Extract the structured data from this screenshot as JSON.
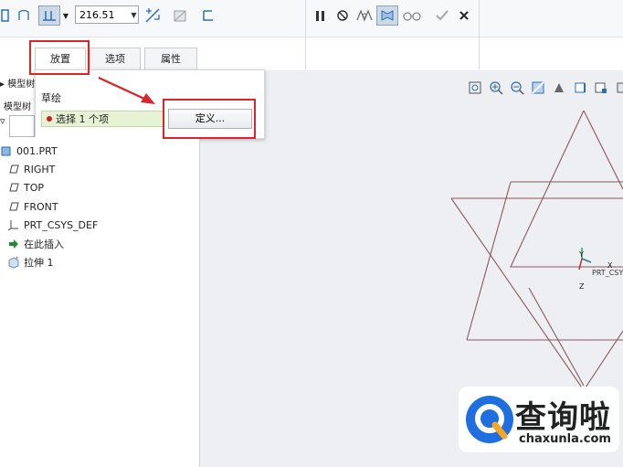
{
  "toolbar": {
    "dimension_value": "216.51"
  },
  "tabs": [
    {
      "label": "放置"
    },
    {
      "label": "选项"
    },
    {
      "label": "属性"
    }
  ],
  "left_partial": {
    "model_label_1": "模型树",
    "model_label_2": "模型树"
  },
  "panel": {
    "sketch_label": "草绘",
    "collector_text": "选择 1 个项",
    "define_label": "定义..."
  },
  "tree": [
    {
      "label": "001.PRT",
      "icon": "part-icon"
    },
    {
      "label": "RIGHT",
      "icon": "datum-plane-icon"
    },
    {
      "label": "TOP",
      "icon": "datum-plane-icon"
    },
    {
      "label": "FRONT",
      "icon": "datum-plane-icon"
    },
    {
      "label": "PRT_CSYS_DEF",
      "icon": "csys-icon"
    },
    {
      "label": "在此插入",
      "icon": "insert-arrow-icon"
    },
    {
      "label": "拉伸 1",
      "icon": "extrude-icon"
    }
  ],
  "csys": {
    "x_label": "X",
    "y_label": "Y",
    "z_label": "Z",
    "name": "PRT_CSYS"
  },
  "watermark": {
    "name": "查询啦",
    "domain": "chaxunla.com"
  },
  "colors": {
    "highlight_red": "#d9252b",
    "sketch_line": "#8a5a5a",
    "collector_bg": "#e5f2d4",
    "toolbar_bg": "#f7f8fa",
    "graphics_bg": "#edeff2"
  }
}
